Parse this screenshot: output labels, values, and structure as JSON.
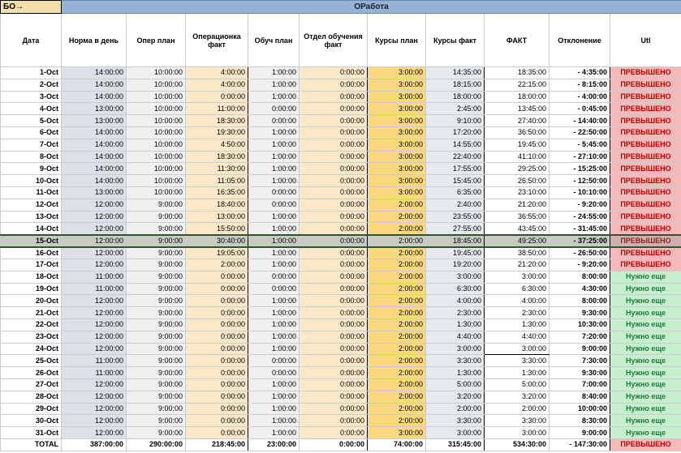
{
  "header": {
    "corner_label": "БО→",
    "band_title": "ОРабота",
    "date_label": "Дата",
    "columns": [
      "Норма в день",
      "Опер план",
      "Операционка факт",
      "Обуч план",
      "Отдел обучения факт",
      "Курсы план",
      "Курсы факт",
      "ФАКТ",
      "Отклонение",
      "Utl"
    ]
  },
  "rows": [
    {
      "date": "1-Oct",
      "norm": "14:00:00",
      "oper_plan": "10:00:00",
      "oper_fact": "4:00:00",
      "teach_plan": "1:00:00",
      "teach_fact": "0:00:00",
      "course_plan": "3:00:00",
      "course_fact": "14:35:00",
      "fact": "18:35:00",
      "deviation": "- 4:35:00",
      "utl": "ПРЕВЫШЕНО",
      "status": "over"
    },
    {
      "date": "2-Oct",
      "norm": "14:00:00",
      "oper_plan": "10:00:00",
      "oper_fact": "4:00:00",
      "teach_plan": "1:00:00",
      "teach_fact": "0:00:00",
      "course_plan": "3:00:00",
      "course_fact": "18:15:00",
      "fact": "22:15:00",
      "deviation": "- 8:15:00",
      "utl": "ПРЕВЫШЕНО",
      "status": "over"
    },
    {
      "date": "3-Oct",
      "norm": "14:00:00",
      "oper_plan": "10:00:00",
      "oper_fact": "0:00:00",
      "teach_plan": "1:00:00",
      "teach_fact": "0:00:00",
      "course_plan": "3:00:00",
      "course_fact": "18:00:00",
      "fact": "18:00:00",
      "deviation": "- 4:00:00",
      "utl": "ПРЕВЫШЕНО",
      "status": "over"
    },
    {
      "date": "4-Oct",
      "norm": "13:00:00",
      "oper_plan": "10:00:00",
      "oper_fact": "11:00:00",
      "teach_plan": "0:00:00",
      "teach_fact": "0:00:00",
      "course_plan": "3:00:00",
      "course_fact": "2:45:00",
      "fact": "13:45:00",
      "deviation": "- 0:45:00",
      "utl": "ПРЕВЫШЕНО",
      "status": "over"
    },
    {
      "date": "5-Oct",
      "norm": "13:00:00",
      "oper_plan": "10:00:00",
      "oper_fact": "18:30:00",
      "teach_plan": "0:00:00",
      "teach_fact": "0:00:00",
      "course_plan": "3:00:00",
      "course_fact": "9:10:00",
      "fact": "27:40:00",
      "deviation": "- 14:40:00",
      "utl": "ПРЕВЫШЕНО",
      "status": "over"
    },
    {
      "date": "6-Oct",
      "norm": "14:00:00",
      "oper_plan": "10:00:00",
      "oper_fact": "19:30:00",
      "teach_plan": "1:00:00",
      "teach_fact": "0:00:00",
      "course_plan": "3:00:00",
      "course_fact": "17:20:00",
      "fact": "36:50:00",
      "deviation": "- 22:50:00",
      "utl": "ПРЕВЫШЕНО",
      "status": "over"
    },
    {
      "date": "7-Oct",
      "norm": "14:00:00",
      "oper_plan": "10:00:00",
      "oper_fact": "4:50:00",
      "teach_plan": "1:00:00",
      "teach_fact": "0:00:00",
      "course_plan": "3:00:00",
      "course_fact": "14:55:00",
      "fact": "19:45:00",
      "deviation": "- 5:45:00",
      "utl": "ПРЕВЫШЕНО",
      "status": "over"
    },
    {
      "date": "8-Oct",
      "norm": "14:00:00",
      "oper_plan": "10:00:00",
      "oper_fact": "18:30:00",
      "teach_plan": "1:00:00",
      "teach_fact": "0:00:00",
      "course_plan": "3:00:00",
      "course_fact": "22:40:00",
      "fact": "41:10:00",
      "deviation": "- 27:10:00",
      "utl": "ПРЕВЫШЕНО",
      "status": "over"
    },
    {
      "date": "9-Oct",
      "norm": "14:00:00",
      "oper_plan": "10:00:00",
      "oper_fact": "11:30:00",
      "teach_plan": "1:00:00",
      "teach_fact": "0:00:00",
      "course_plan": "3:00:00",
      "course_fact": "17:55:00",
      "fact": "29:25:00",
      "deviation": "- 15:25:00",
      "utl": "ПРЕВЫШЕНО",
      "status": "over"
    },
    {
      "date": "10-Oct",
      "norm": "14:00:00",
      "oper_plan": "10:00:00",
      "oper_fact": "11:05:00",
      "teach_plan": "1:00:00",
      "teach_fact": "0:00:00",
      "course_plan": "3:00:00",
      "course_fact": "15:45:00",
      "fact": "26:50:00",
      "deviation": "- 12:50:00",
      "utl": "ПРЕВЫШЕНО",
      "status": "over"
    },
    {
      "date": "11-Oct",
      "norm": "13:00:00",
      "oper_plan": "10:00:00",
      "oper_fact": "16:35:00",
      "teach_plan": "0:00:00",
      "teach_fact": "0:00:00",
      "course_plan": "3:00:00",
      "course_fact": "6:35:00",
      "fact": "23:10:00",
      "deviation": "- 10:10:00",
      "utl": "ПРЕВЫШЕНО",
      "status": "over"
    },
    {
      "date": "12-Oct",
      "norm": "12:00:00",
      "oper_plan": "9:00:00",
      "oper_fact": "18:40:00",
      "teach_plan": "0:00:00",
      "teach_fact": "0:00:00",
      "course_plan": "2:00:00",
      "course_fact": "2:40:00",
      "fact": "21:20:00",
      "deviation": "- 9:20:00",
      "utl": "ПРЕВЫШЕНО",
      "status": "over"
    },
    {
      "date": "13-Oct",
      "norm": "12:00:00",
      "oper_plan": "9:00:00",
      "oper_fact": "13:00:00",
      "teach_plan": "1:00:00",
      "teach_fact": "0:00:00",
      "course_plan": "2:00:00",
      "course_fact": "23:55:00",
      "fact": "36:55:00",
      "deviation": "- 24:55:00",
      "utl": "ПРЕВЫШЕНО",
      "status": "over"
    },
    {
      "date": "14-Oct",
      "norm": "12:00:00",
      "oper_plan": "9:00:00",
      "oper_fact": "15:50:00",
      "teach_plan": "1:00:00",
      "teach_fact": "0:00:00",
      "course_plan": "2:00:00",
      "course_fact": "27:55:00",
      "fact": "43:45:00",
      "deviation": "- 31:45:00",
      "utl": "ПРЕВЫШЕНО",
      "status": "over"
    },
    {
      "date": "15-Oct",
      "norm": "12:00:00",
      "oper_plan": "9:00:00",
      "oper_fact": "30:40:00",
      "teach_plan": "1:00:00",
      "teach_fact": "0:00:00",
      "course_plan": "2:00:00",
      "course_fact": "18:45:00",
      "fact": "49:25:00",
      "deviation": "- 37:25:00",
      "utl": "ПРЕВЫШЕНО",
      "status": "over",
      "selected": true
    },
    {
      "date": "16-Oct",
      "norm": "12:00:00",
      "oper_plan": "9:00:00",
      "oper_fact": "19:05:00",
      "teach_plan": "1:00:00",
      "teach_fact": "0:00:00",
      "course_plan": "2:00:00",
      "course_fact": "19:45:00",
      "fact": "38:50:00",
      "deviation": "- 26:50:00",
      "utl": "ПРЕВЫШЕНО",
      "status": "over"
    },
    {
      "date": "17-Oct",
      "norm": "12:00:00",
      "oper_plan": "9:00:00",
      "oper_fact": "2:00:00",
      "teach_plan": "1:00:00",
      "teach_fact": "0:00:00",
      "course_plan": "2:00:00",
      "course_fact": "19:20:00",
      "fact": "21:20:00",
      "deviation": "- 9:20:00",
      "utl": "ПРЕВЫШЕНО",
      "status": "over"
    },
    {
      "date": "18-Oct",
      "norm": "11:00:00",
      "oper_plan": "9:00:00",
      "oper_fact": "0:00:00",
      "teach_plan": "0:00:00",
      "teach_fact": "0:00:00",
      "course_plan": "2:00:00",
      "course_fact": "3:00:00",
      "fact": "3:00:00",
      "deviation": "8:00:00",
      "utl": "Нужно еще",
      "status": "need"
    },
    {
      "date": "19-Oct",
      "norm": "11:00:00",
      "oper_plan": "9:00:00",
      "oper_fact": "0:00:00",
      "teach_plan": "0:00:00",
      "teach_fact": "0:00:00",
      "course_plan": "2:00:00",
      "course_fact": "6:30:00",
      "fact": "6:30:00",
      "deviation": "4:30:00",
      "utl": "Нужно еще",
      "status": "need"
    },
    {
      "date": "20-Oct",
      "norm": "12:00:00",
      "oper_plan": "9:00:00",
      "oper_fact": "0:00:00",
      "teach_plan": "1:00:00",
      "teach_fact": "0:00:00",
      "course_plan": "2:00:00",
      "course_fact": "4:00:00",
      "fact": "4:00:00",
      "deviation": "8:00:00",
      "utl": "Нужно еще",
      "status": "need"
    },
    {
      "date": "21-Oct",
      "norm": "12:00:00",
      "oper_plan": "9:00:00",
      "oper_fact": "0:00:00",
      "teach_plan": "1:00:00",
      "teach_fact": "0:00:00",
      "course_plan": "2:00:00",
      "course_fact": "2:30:00",
      "fact": "2:30:00",
      "deviation": "9:30:00",
      "utl": "Нужно еще",
      "status": "need"
    },
    {
      "date": "22-Oct",
      "norm": "12:00:00",
      "oper_plan": "9:00:00",
      "oper_fact": "0:00:00",
      "teach_plan": "1:00:00",
      "teach_fact": "0:00:00",
      "course_plan": "2:00:00",
      "course_fact": "1:30:00",
      "fact": "1:30:00",
      "deviation": "10:30:00",
      "utl": "Нужно еще",
      "status": "need"
    },
    {
      "date": "23-Oct",
      "norm": "12:00:00",
      "oper_plan": "9:00:00",
      "oper_fact": "0:00:00",
      "teach_plan": "1:00:00",
      "teach_fact": "0:00:00",
      "course_plan": "2:00:00",
      "course_fact": "4:40:00",
      "fact": "4:40:00",
      "deviation": "7:20:00",
      "utl": "Нужно еще",
      "status": "need"
    },
    {
      "date": "24-Oct",
      "norm": "12:00:00",
      "oper_plan": "9:00:00",
      "oper_fact": "0:00:00",
      "teach_plan": "1:00:00",
      "teach_fact": "0:00:00",
      "course_plan": "2:00:00",
      "course_fact": "3:00:00",
      "fact": "3:00:00",
      "deviation": "9:00:00",
      "utl": "Нужно еще",
      "status": "need",
      "underline_fact": true
    },
    {
      "date": "25-Oct",
      "norm": "11:00:00",
      "oper_plan": "9:00:00",
      "oper_fact": "0:00:00",
      "teach_plan": "0:00:00",
      "teach_fact": "0:00:00",
      "course_plan": "2:00:00",
      "course_fact": "3:30:00",
      "fact": "3:30:00",
      "deviation": "7:30:00",
      "utl": "Нужно еще",
      "status": "need"
    },
    {
      "date": "26-Oct",
      "norm": "11:00:00",
      "oper_plan": "9:00:00",
      "oper_fact": "0:00:00",
      "teach_plan": "0:00:00",
      "teach_fact": "0:00:00",
      "course_plan": "2:00:00",
      "course_fact": "1:30:00",
      "fact": "1:30:00",
      "deviation": "9:30:00",
      "utl": "Нужно еще",
      "status": "need"
    },
    {
      "date": "27-Oct",
      "norm": "12:00:00",
      "oper_plan": "9:00:00",
      "oper_fact": "0:00:00",
      "teach_plan": "1:00:00",
      "teach_fact": "0:00:00",
      "course_plan": "2:00:00",
      "course_fact": "5:00:00",
      "fact": "5:00:00",
      "deviation": "7:00:00",
      "utl": "Нужно еще",
      "status": "need"
    },
    {
      "date": "28-Oct",
      "norm": "12:00:00",
      "oper_plan": "9:00:00",
      "oper_fact": "0:00:00",
      "teach_plan": "1:00:00",
      "teach_fact": "0:00:00",
      "course_plan": "2:00:00",
      "course_fact": "3:20:00",
      "fact": "3:20:00",
      "deviation": "8:40:00",
      "utl": "Нужно еще",
      "status": "need"
    },
    {
      "date": "29-Oct",
      "norm": "12:00:00",
      "oper_plan": "9:00:00",
      "oper_fact": "0:00:00",
      "teach_plan": "1:00:00",
      "teach_fact": "0:00:00",
      "course_plan": "2:00:00",
      "course_fact": "2:00:00",
      "fact": "2:00:00",
      "deviation": "10:00:00",
      "utl": "Нужно еще",
      "status": "need"
    },
    {
      "date": "30-Oct",
      "norm": "12:00:00",
      "oper_plan": "9:00:00",
      "oper_fact": "0:00:00",
      "teach_plan": "1:00:00",
      "teach_fact": "0:00:00",
      "course_plan": "2:00:00",
      "course_fact": "3:30:00",
      "fact": "3:30:00",
      "deviation": "8:30:00",
      "utl": "Нужно еще",
      "status": "need"
    },
    {
      "date": "31-Oct",
      "norm": "12:00:00",
      "oper_plan": "9:00:00",
      "oper_fact": "0:00:00",
      "teach_plan": "1:00:00",
      "teach_fact": "0:00:00",
      "course_plan": "3:00:00",
      "course_fact": "3:00:00",
      "fact": "3:00:00",
      "deviation": "9:00:00",
      "utl": "Нужно еще",
      "status": "need"
    }
  ],
  "total": {
    "date": "TOTAL",
    "norm": "387:00:00",
    "oper_plan": "290:00:00",
    "oper_fact": "218:45:00",
    "teach_plan": "23:00:00",
    "teach_fact": "0:00:00",
    "course_plan": "74:00:00",
    "course_fact": "315:45:00",
    "fact": "534:30:00",
    "deviation": "- 147:30:00",
    "utl": "ПРЕВЫШЕНО",
    "status": "over"
  },
  "colors": {
    "band_bg": "#95B3D7",
    "corner_bg": "#F2DFA9",
    "norm_bg": "#DCE0E7",
    "plan_bg": "#F0F0F0",
    "fact_warm_bg": "#FBE8C8",
    "course_plan_bg": "#FAD87E",
    "course_fact_bg": "#E6E9ED",
    "over_bg": "#F5B9B9",
    "over_text": "#C00000",
    "need_bg": "#C6EFCE",
    "need_text": "#1F7A3C",
    "grid": "#C9CDD1",
    "selected_bg": "#C7CBC2",
    "selected_border": "#33522E"
  }
}
